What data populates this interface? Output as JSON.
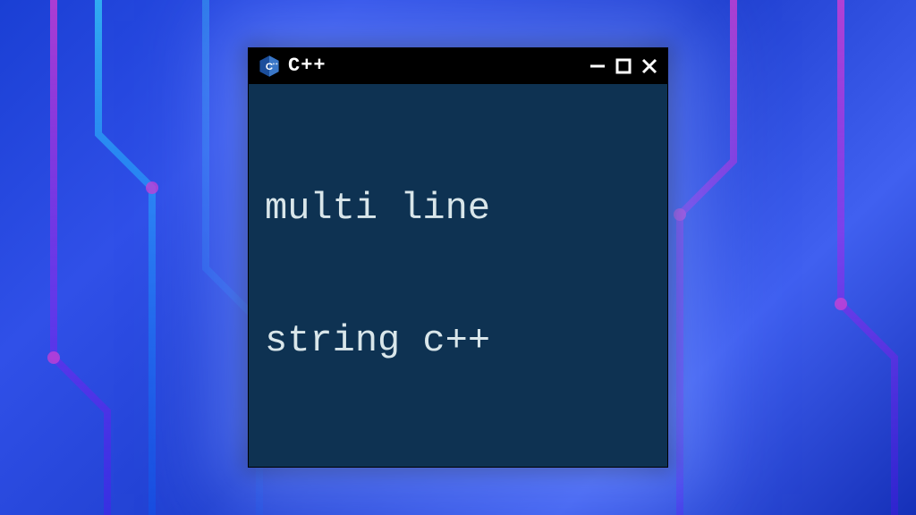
{
  "window": {
    "title": "C++",
    "icon": "cpp-logo"
  },
  "content": {
    "lines": [
      "multi line",
      "string c++"
    ]
  },
  "colors": {
    "terminal_bg": "#0e3252",
    "titlebar_bg": "#000000",
    "text": "#d9e6ea"
  }
}
